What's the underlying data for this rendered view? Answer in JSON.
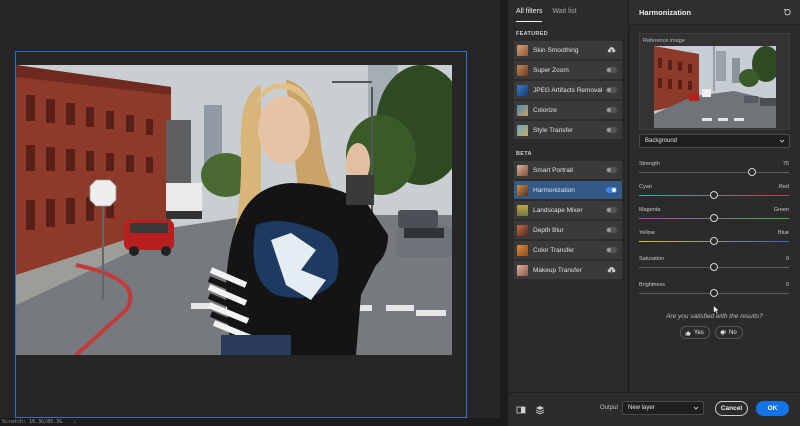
{
  "filters_panel": {
    "tabs": [
      {
        "label": "All filters",
        "active": true
      },
      {
        "label": "Wait list",
        "active": false
      }
    ],
    "featured_title": "FEATURED",
    "featured": [
      {
        "label": "Skin Smoothing",
        "control": "cloud-download-icon"
      },
      {
        "label": "Super Zoom",
        "control": "toggle-off"
      },
      {
        "label": "JPEG Artifacts Removal",
        "control": "toggle-off"
      },
      {
        "label": "Colorize",
        "control": "toggle-off"
      },
      {
        "label": "Style Transfer",
        "control": "toggle-off"
      }
    ],
    "beta_title": "BETA",
    "beta": [
      {
        "label": "Smart Portrait",
        "control": "toggle-off"
      },
      {
        "label": "Harmonization",
        "control": "toggle-on",
        "selected": true
      },
      {
        "label": "Landscape Mixer",
        "control": "toggle-off"
      },
      {
        "label": "Depth Blur",
        "control": "toggle-off"
      },
      {
        "label": "Color Transfer",
        "control": "toggle-off"
      },
      {
        "label": "Makeup Transfer",
        "control": "cloud-download-icon"
      }
    ]
  },
  "props": {
    "title": "Harmonization",
    "reference_label": "Reference image",
    "layer_select": "Background",
    "sliders": [
      {
        "label": "Strength",
        "right": "75",
        "value": 75,
        "min": 0,
        "max": 100,
        "gradient": false
      },
      {
        "label": "Cyan",
        "right": "Red",
        "value": 0,
        "min": -50,
        "max": 50,
        "gradient": [
          "#25b3c9",
          "#d23838"
        ]
      },
      {
        "label": "Magenta",
        "right": "Green",
        "value": 0,
        "min": -50,
        "max": 50,
        "gradient": [
          "#c23ac2",
          "#3fb03f"
        ]
      },
      {
        "label": "Yellow",
        "right": "Blue",
        "value": 0,
        "min": -50,
        "max": 50,
        "gradient": [
          "#d8c232",
          "#3a5fd0"
        ]
      },
      {
        "label": "Saturation",
        "right": "0",
        "value": 0,
        "min": -50,
        "max": 50,
        "gradient": false
      },
      {
        "label": "Brightness",
        "right": "0",
        "value": 0,
        "min": -50,
        "max": 50,
        "gradient": false
      }
    ],
    "question": "Are you satisfied with the results?",
    "yes_label": "Yes",
    "no_label": "No"
  },
  "footer": {
    "output_label": "Output",
    "output_select": "New layer",
    "cancel_label": "Cancel",
    "ok_label": "OK"
  },
  "status": {
    "zoom": "Scratch: 16.3G/85.3G"
  },
  "colors": {
    "accent": "#1473e6",
    "selected_row": "#345a88",
    "artboard_border": "#2d6fd0"
  }
}
